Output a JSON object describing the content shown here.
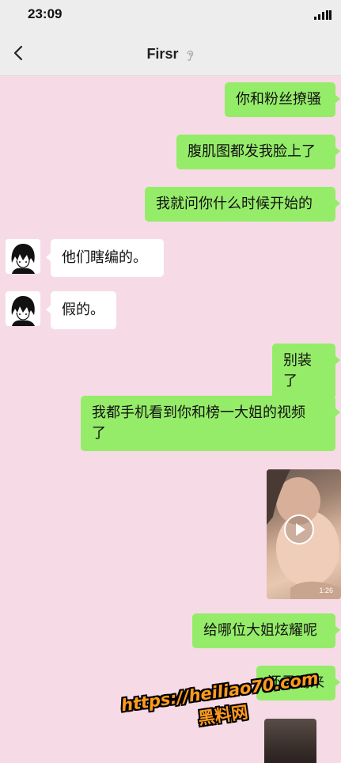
{
  "status_bar": {
    "time": "23:09"
  },
  "nav": {
    "title": "Firsr",
    "back_icon": "chevron-left-icon",
    "ear_icon": "ear-icon"
  },
  "messages": [
    {
      "side": "right",
      "type": "text",
      "text": "你和粉丝撩骚"
    },
    {
      "side": "right",
      "type": "text",
      "text": "腹肌图都发我脸上了"
    },
    {
      "side": "right",
      "type": "text",
      "text": "我就问你什么时候开始的"
    },
    {
      "side": "left",
      "type": "text",
      "text": "他们瞎编的。"
    },
    {
      "side": "left",
      "type": "text",
      "text": "假的。"
    },
    {
      "side": "right",
      "type": "text",
      "text": "别装了"
    },
    {
      "side": "right",
      "type": "text",
      "line1": "我都手机看到你和榜一大姐的视频",
      "line2": "了"
    },
    {
      "side": "right",
      "type": "video",
      "duration": "1:26"
    },
    {
      "side": "right",
      "type": "text",
      "text": "给哪位大姐炫耀呢"
    },
    {
      "side": "right",
      "type": "text",
      "text": "还录而来"
    },
    {
      "side": "right",
      "type": "image"
    }
  ],
  "watermark": {
    "url": "https://heiliao70.com",
    "name": "黑料网"
  },
  "colors": {
    "background": "#f6dbe6",
    "sent_bubble": "#95ec69",
    "received_bubble": "#ffffff",
    "bar": "#ededed",
    "watermark": "#ff9a1f"
  }
}
